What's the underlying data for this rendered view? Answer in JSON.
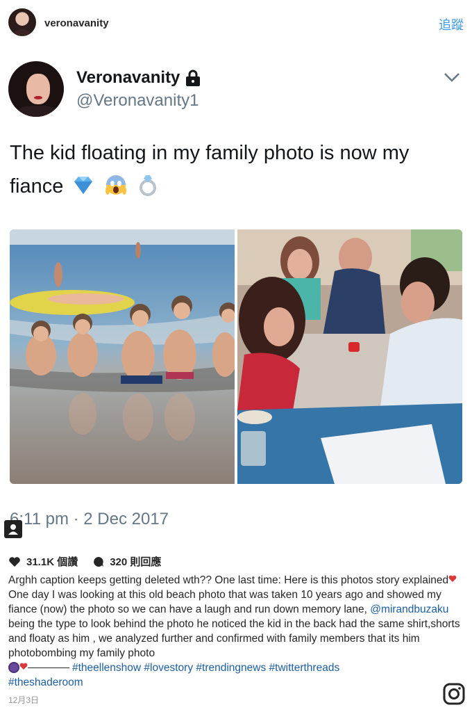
{
  "header": {
    "username": "veronavanity",
    "follow_label": "追蹤"
  },
  "tweet": {
    "display_name": "Veronavanity",
    "handle": "@Veronavanity1",
    "text": "The kid floating in my family photo is now my fiance",
    "emojis": [
      "gem-icon",
      "screaming-face-icon",
      "ring-icon"
    ],
    "timestamp": "6:11 pm · 2 Dec 2017"
  },
  "stats": {
    "likes": "31.1K 個讚",
    "comments": "320 則回應"
  },
  "caption": {
    "part1": "Arghh caption keeps getting deleted wth?? One last time: Here is this photos story explained",
    "part2": "One day I was looking at this old beach photo that was taken 10 years ago and showed my fiance (now) the photo so we can have a laugh and run down memory lane, ",
    "mention": "@mirandbuzaku",
    "part3": " being the type to look behind the photo he noticed the kid in the back had the same shirt,shorts and floaty as him , we analyzed further and confirmed with family members that its him photobombing my family photo",
    "hashtags": [
      "#theellenshow",
      "#lovestory",
      "#trendingnews",
      "#twitterthreads",
      "#theshaderoom"
    ]
  },
  "post_date": "12月3日",
  "colors": {
    "link_blue": "#3897f0",
    "tag_blue": "#1d5ea3",
    "text_dark": "#262626",
    "twitter_gray": "#657786"
  }
}
